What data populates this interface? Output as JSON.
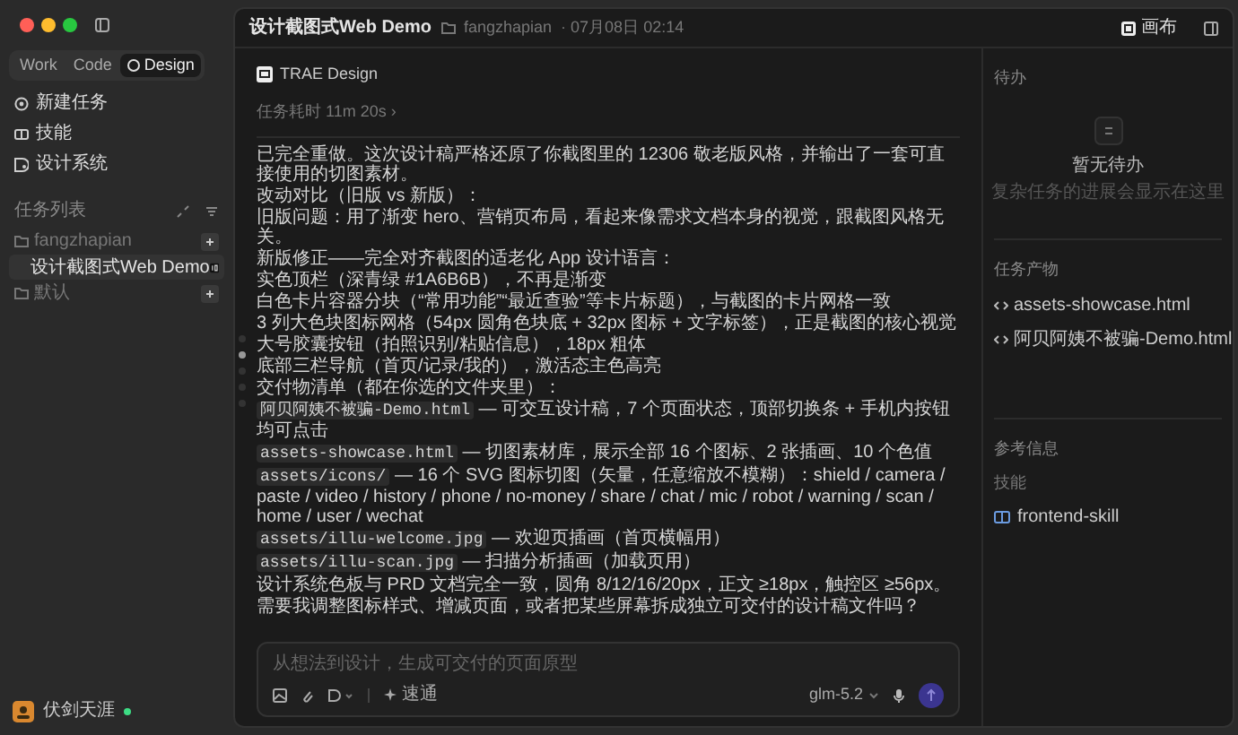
{
  "sidebar": {
    "mode_tabs": [
      {
        "label": "Work",
        "selected": false
      },
      {
        "label": "Code",
        "selected": false
      },
      {
        "label": "Design",
        "selected": true
      }
    ],
    "nav_items": [
      {
        "kind": "new",
        "label": "新建任务"
      },
      {
        "kind": "skills",
        "label": "技能"
      },
      {
        "kind": "design",
        "label": "设计系统"
      }
    ],
    "section_title": "任务列表",
    "folders": [
      {
        "label": "fangzhapian",
        "children": [
          {
            "label": "设计截图式Web Demo",
            "selected": true
          }
        ]
      },
      {
        "label": "默认"
      }
    ],
    "user": {
      "name": "伏剑天涯",
      "online": true
    }
  },
  "header": {
    "title": "设计截图式Web Demo",
    "folder": "fangzhapian",
    "date": "· 07月08日 02:14",
    "canvas_button": "画布"
  },
  "message": {
    "sender": "TRAE Design",
    "duration": "任务耗时 11m 20s ›",
    "paragraphs": [
      {
        "text": "已完全重做。这次设计稿严格还原了你截图里的 12306 敬老版风格，并输出了一套可直接使用的切图素材。"
      },
      {
        "text": "改动对比（旧版 vs 新版）："
      },
      {
        "text": "旧版问题：用了渐变 hero、营销页布局，看起来像需求文档本身的视觉，跟截图风格无关。"
      },
      {
        "text": "新版修正——完全对齐截图的适老化 App 设计语言："
      },
      {
        "text": "实色顶栏（深青绿 #1A6B6B），不再是渐变"
      },
      {
        "text": "白色卡片容器分块（“常用功能”“最近查验”等卡片标题），与截图的卡片网格一致"
      },
      {
        "text": "3 列大色块图标网格（54px 圆角色块底 + 32px 图标 + 文字标签），正是截图的核心视觉"
      },
      {
        "text": "大号胶囊按钮（拍照识别/粘贴信息），18px 粗体"
      },
      {
        "text": "底部三栏导航（首页/记录/我的），激活态主色高亮"
      },
      {
        "text": "交付物清单（都在你选的文件夹里）："
      },
      {
        "code": "阿贝阿姨不被骗-Demo.html",
        "text": "— 可交互设计稿，7 个页面状态，顶部切换条 + 手机内按钮均可点击"
      },
      {
        "code": "assets-showcase.html",
        "text": "— 切图素材库，展示全部 16 个图标、2 张插画、10 个色值"
      },
      {
        "code": "assets/icons/",
        "text": "— 16 个 SVG 图标切图（矢量，任意缩放不模糊）：shield / camera / paste / video / history / phone / no-money / share / chat / mic / robot / warning / scan / home / user / wechat"
      },
      {
        "code": "assets/illu-welcome.jpg",
        "text": "— 欢迎页插画（首页横幅用）"
      },
      {
        "code": "assets/illu-scan.jpg",
        "text": "— 扫描分析插画（加载页用）"
      },
      {
        "text": "设计系统色板与 PRD 文档完全一致，圆角 8/12/16/20px，正文 ≥18px，触控区 ≥56px。"
      },
      {
        "text": "需要我调整图标样式、增减页面，或者把某些屏幕拆成独立可交付的设计稿文件吗？"
      }
    ]
  },
  "outline_dots": [
    {
      "selected": false
    },
    {
      "selected": true
    },
    {
      "selected": false
    },
    {
      "selected": false
    },
    {
      "selected": false
    }
  ],
  "composer": {
    "placeholder": "从想法到设计，生成可交付的页面原型",
    "mode": "速通",
    "model": "glm-5.2"
  },
  "right_panel": {
    "todo_title": "待办",
    "todo_empty": "暂无待办",
    "todo_hint": "复杂任务的进展会显示在这里",
    "outputs_title": "任务产物",
    "outputs": [
      "assets-showcase.html",
      "阿贝阿姨不被骗-Demo.html"
    ],
    "reference_title": "参考信息",
    "skills_title": "技能",
    "skills": [
      "frontend-skill"
    ]
  }
}
